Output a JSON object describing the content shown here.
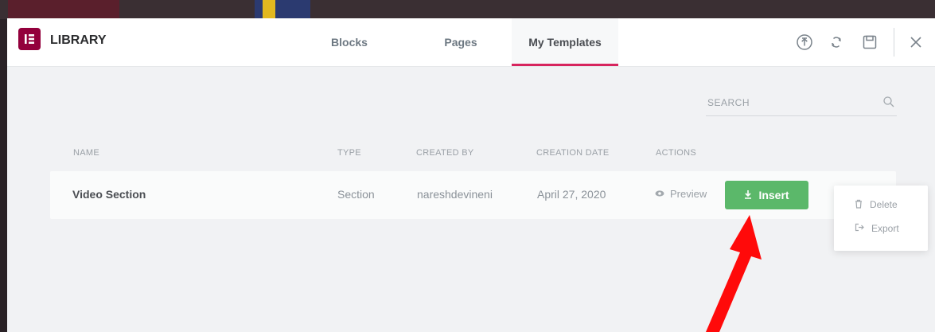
{
  "header": {
    "title": "LIBRARY",
    "logo_glyph": "IE",
    "tabs": [
      {
        "label": "Blocks"
      },
      {
        "label": "Pages"
      },
      {
        "label": "My Templates",
        "active": true
      }
    ],
    "icons": [
      "upload-icon",
      "sync-icon",
      "save-icon",
      "close-icon"
    ]
  },
  "search": {
    "placeholder": "SEARCH"
  },
  "table": {
    "headers": [
      "NAME",
      "TYPE",
      "CREATED BY",
      "CREATION DATE",
      "ACTIONS"
    ],
    "rows": [
      {
        "name": "Video Section",
        "type": "Section",
        "created_by": "nareshdevineni",
        "date": "April 27, 2020",
        "preview": "Preview",
        "insert": "Insert",
        "more": "···"
      }
    ]
  },
  "menu": {
    "items": [
      {
        "label": "Delete"
      },
      {
        "label": "Export"
      }
    ]
  },
  "colors": {
    "accent": "#d7255e",
    "insert": "#5bb86a",
    "logo": "#93003c",
    "arrow": "#ff0000"
  }
}
